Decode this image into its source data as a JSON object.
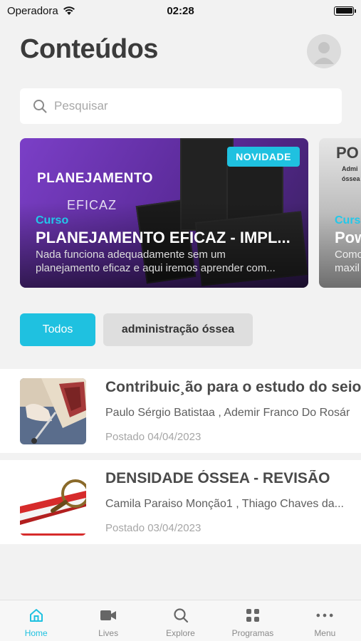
{
  "status_bar": {
    "carrier": "Operadora",
    "time": "02:28"
  },
  "header": {
    "title": "Conteúdos"
  },
  "search": {
    "placeholder": "Pesquisar"
  },
  "carousel": [
    {
      "badge": "NOVIDADE",
      "art_title": "PLANEJAMENTO",
      "art_subtitle": "EFICAZ",
      "type": "Curso",
      "title": "PLANEJAMENTO EFICAZ - IMPL...",
      "description": "Nada funciona adequadamente sem um planejamento eficaz e aqui iremos aprender com..."
    },
    {
      "logo": "PO",
      "small_text_1": "Admi",
      "small_text_2": "óssea",
      "type": "Curso",
      "title": "Pow",
      "description": "Como",
      "description_2": "maxil"
    }
  ],
  "filters": [
    {
      "label": "Todos",
      "active": true
    },
    {
      "label": "administração óssea",
      "active": false
    }
  ],
  "items": [
    {
      "title": "Contribuic¸ão para o estudo do seio m",
      "authors": "Paulo Sérgio Batistaa , Ademir Franco Do Rosár",
      "date": "Postado 04/04/2023"
    },
    {
      "title": "DENSIDADE ÓSSEA - REVISÃO",
      "authors": "Camila Paraiso Monção1 , Thiago Chaves da...",
      "date": "Postado 03/04/2023"
    }
  ],
  "tabs": [
    {
      "label": "Home",
      "icon": "home-icon",
      "active": true
    },
    {
      "label": "Lives",
      "icon": "video-camera-icon",
      "active": false
    },
    {
      "label": "Explore",
      "icon": "search-icon",
      "active": false
    },
    {
      "label": "Programas",
      "icon": "grid-icon",
      "active": false
    },
    {
      "label": "Menu",
      "icon": "more-dots-icon",
      "active": false
    }
  ],
  "colors": {
    "accent": "#1fc1e0",
    "background": "#f2f2f2",
    "card_purple": "#7b3fc7"
  }
}
